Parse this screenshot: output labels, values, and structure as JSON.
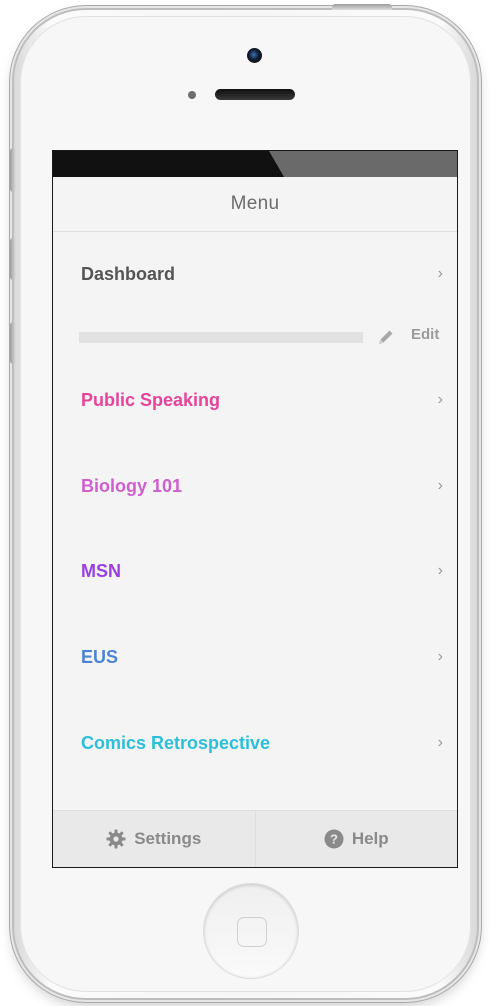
{
  "menu": {
    "title": "Menu"
  },
  "dashboard": {
    "label": "Dashboard",
    "chevron": "›"
  },
  "section": {
    "edit_label": "Edit",
    "edit_icon": "pencil-icon"
  },
  "courses": [
    {
      "label": "Public Speaking",
      "color": "#e6449a",
      "chevron": "›"
    },
    {
      "label": "Biology 101",
      "color": "#cf5fcf",
      "chevron": "›"
    },
    {
      "label": "MSN",
      "color": "#9b3fe0",
      "chevron": "›"
    },
    {
      "label": "EUS",
      "color": "#4c84d6",
      "chevron": "›"
    },
    {
      "label": "Comics Retrospective",
      "color": "#2bbfd9",
      "chevron": "›"
    }
  ],
  "tabbar": {
    "settings": {
      "label": "Settings",
      "icon": "gear-icon"
    },
    "help": {
      "label": "Help",
      "icon": "question-circle-icon"
    }
  }
}
